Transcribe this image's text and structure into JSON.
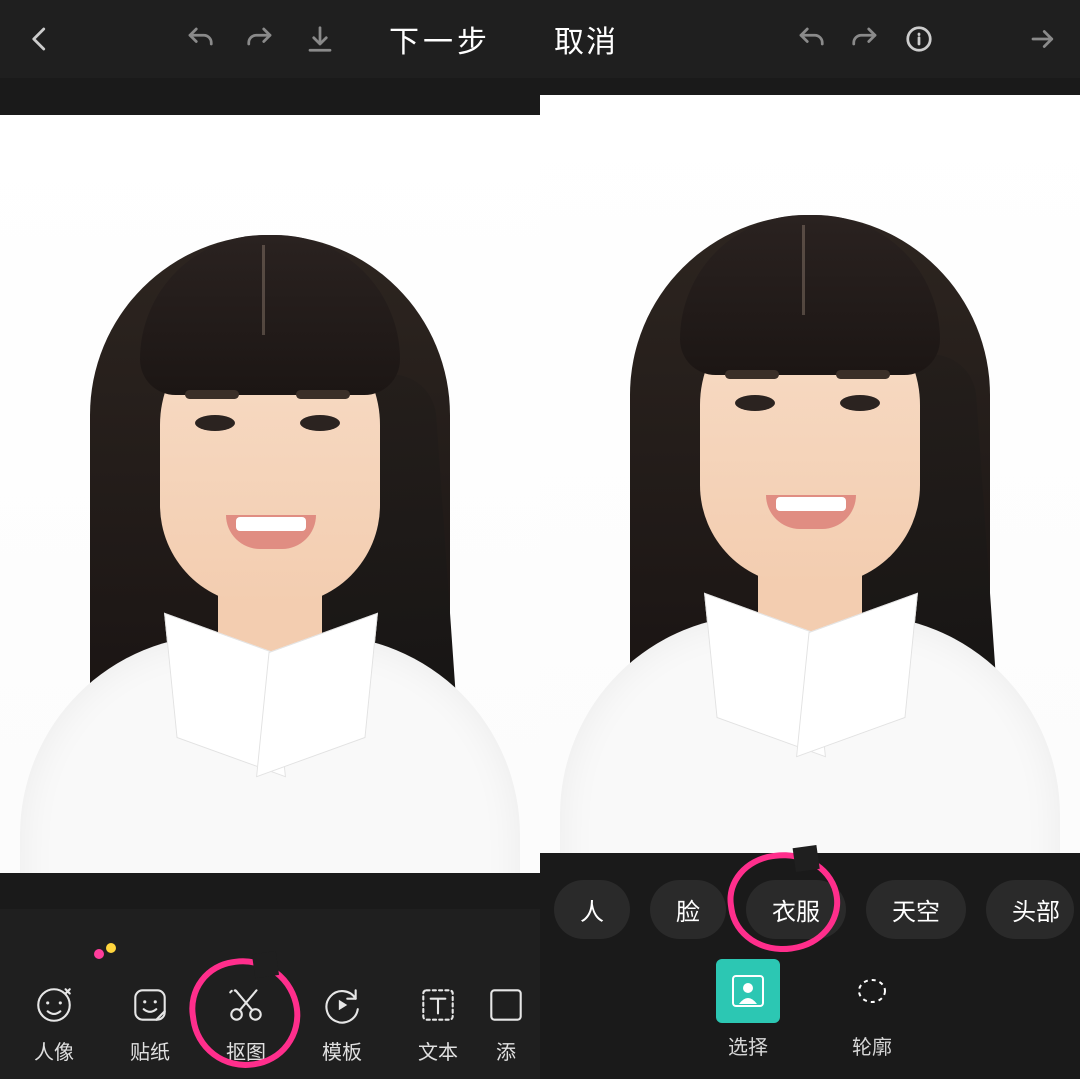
{
  "colors": {
    "accent_pink": "#ff2e8c",
    "accent_teal": "#2cc7b3"
  },
  "left": {
    "top": {
      "back_icon": "chevron-left",
      "undo_icon": "undo",
      "redo_icon": "redo",
      "download_icon": "download",
      "next_label": "下一步"
    },
    "tools": [
      {
        "id": "portrait",
        "label": "人像",
        "icon": "face"
      },
      {
        "id": "sticker",
        "label": "贴纸",
        "icon": "sticker"
      },
      {
        "id": "cutout",
        "label": "抠图",
        "icon": "scissors",
        "highlighted": true
      },
      {
        "id": "template",
        "label": "模板",
        "icon": "replay"
      },
      {
        "id": "text",
        "label": "文本",
        "icon": "text-box"
      },
      {
        "id": "add",
        "label": "添",
        "icon": "add-partial"
      }
    ]
  },
  "right": {
    "top": {
      "cancel_label": "取消",
      "undo_icon": "undo",
      "redo_icon": "redo",
      "info_icon": "info",
      "forward_icon": "arrow-right"
    },
    "chips": [
      {
        "id": "person",
        "label": "人"
      },
      {
        "id": "face",
        "label": "脸"
      },
      {
        "id": "clothes",
        "label": "衣服",
        "highlighted": true
      },
      {
        "id": "sky",
        "label": "天空"
      },
      {
        "id": "head",
        "label": "头部"
      }
    ],
    "modes": [
      {
        "id": "select",
        "label": "选择",
        "icon": "select-person",
        "active": true
      },
      {
        "id": "outline",
        "label": "轮廓",
        "icon": "lasso"
      }
    ]
  }
}
